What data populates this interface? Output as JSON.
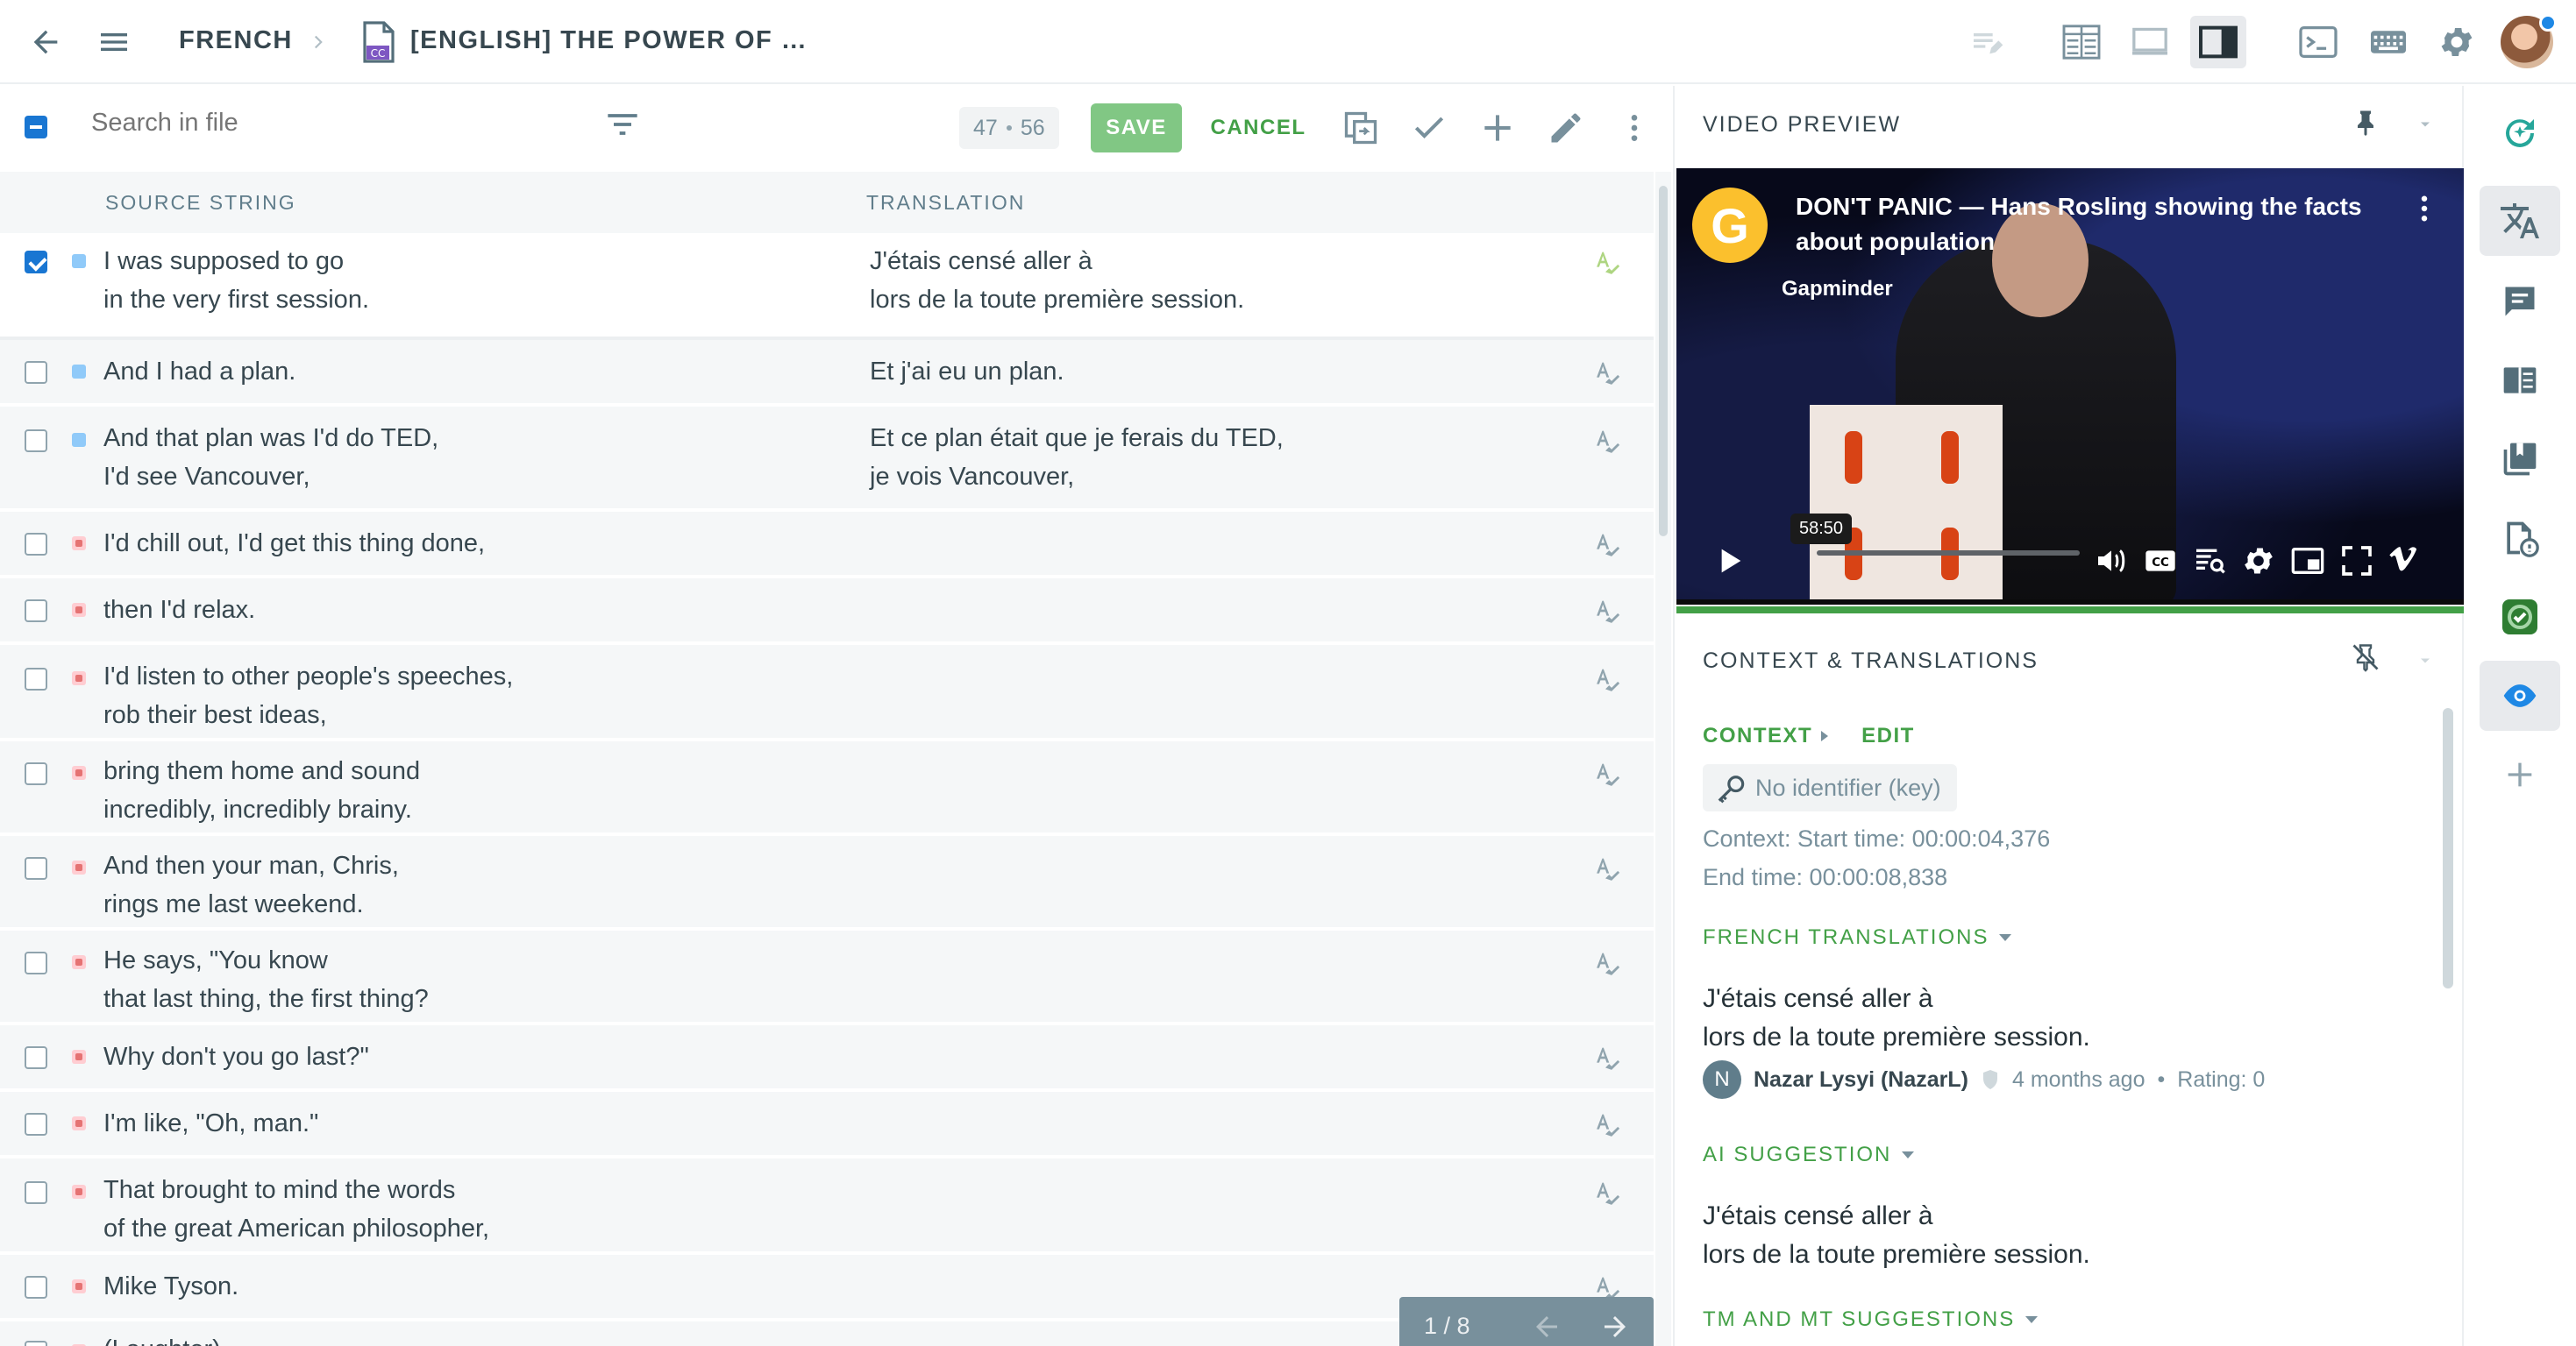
{
  "header": {
    "language": "FRENCH",
    "file_name": "[ENGLISH] THE POWER OF …"
  },
  "toolbar": {
    "search_placeholder": "Search in file",
    "counter_left": "47",
    "counter_right": "56",
    "save_label": "SAVE",
    "cancel_label": "CANCEL"
  },
  "columns": {
    "source": "SOURCE STRING",
    "translation": "TRANSLATION"
  },
  "rows": [
    {
      "source": "I was supposed to go\nin the very first session.",
      "translation": "J'étais censé aller à\nlors de la toute première session.",
      "status": "done",
      "checked": true
    },
    {
      "source": "And I had a plan.",
      "translation": "Et j'ai eu un plan.",
      "status": "done",
      "checked": false
    },
    {
      "source": "And that plan was I'd do TED,\nI'd see Vancouver,",
      "translation": "Et ce plan était que je ferais du TED,\nje vois Vancouver,",
      "status": "done",
      "checked": false
    },
    {
      "source": "I'd chill out, I'd get this thing done,",
      "translation": "",
      "status": "todo",
      "checked": false
    },
    {
      "source": "then I'd relax.",
      "translation": "",
      "status": "todo",
      "checked": false
    },
    {
      "source": "I'd listen to other people's speeches,\nrob their best ideas,",
      "translation": "",
      "status": "todo",
      "checked": false
    },
    {
      "source": "bring them home and sound\nincredibly, incredibly brainy.",
      "translation": "",
      "status": "todo",
      "checked": false
    },
    {
      "source": "And then your man, Chris,\nrings me last weekend.",
      "translation": "",
      "status": "todo",
      "checked": false
    },
    {
      "source": "He says, \"You know\nthat last thing, the first thing?",
      "translation": "",
      "status": "todo",
      "checked": false
    },
    {
      "source": "Why don't you go last?\"",
      "translation": "",
      "status": "todo",
      "checked": false
    },
    {
      "source": "I'm like, \"Oh, man.\"",
      "translation": "",
      "status": "todo",
      "checked": false
    },
    {
      "source": "That brought to mind the words\nof the great American philosopher,",
      "translation": "",
      "status": "todo",
      "checked": false
    },
    {
      "source": "Mike Tyson.",
      "translation": "",
      "status": "todo",
      "checked": false
    },
    {
      "source": "(Laughter)",
      "translation": "",
      "status": "todo",
      "checked": false
    }
  ],
  "pager": {
    "label": "1 / 8"
  },
  "video_preview": {
    "heading": "VIDEO PREVIEW",
    "title": "DON'T PANIC — Hans Rosling showing the facts about population",
    "channel": "Gapminder",
    "timestamp": "58:50",
    "logo_letter": "G"
  },
  "context": {
    "heading": "CONTEXT & TRANSLATIONS",
    "context_link": "CONTEXT",
    "edit_link": "EDIT",
    "identifier": "No identifier (key)",
    "start_time": "Context: Start time: 00:00:04,376",
    "end_time": "End time: 00:00:08,838",
    "french_translations": "FRENCH TRANSLATIONS",
    "translation_text": "J'étais censé aller à\nlors de la toute première session.",
    "user_initial": "N",
    "user_name": "Nazar Lysyi (NazarL)",
    "user_time": "4 months ago",
    "user_rating": "Rating: 0",
    "ai_suggestion": "AI SUGGESTION",
    "ai_text": "J'étais censé aller à\nlors de la toute première session.",
    "tm_mt": "TM AND MT SUGGESTIONS"
  },
  "colors": {
    "accent_green": "#43a047",
    "save_bg": "#81c784",
    "primary_blue": "#1976d2",
    "status_done": "#90caf9",
    "status_todo": "#e57373"
  }
}
